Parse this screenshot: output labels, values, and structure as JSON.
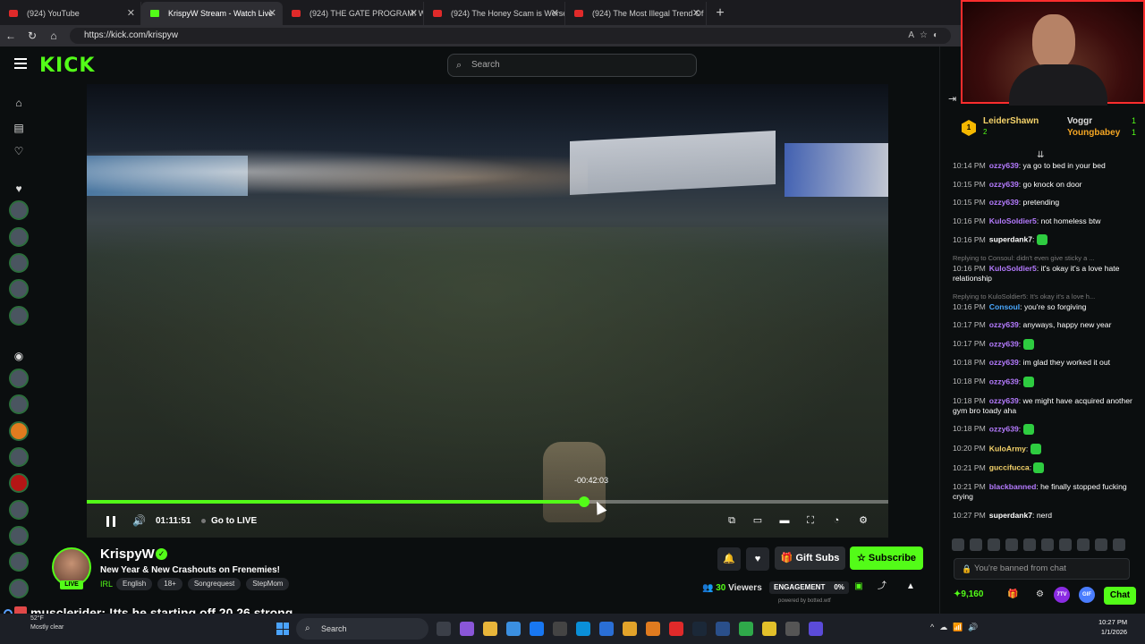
{
  "browser": {
    "tabs": [
      {
        "title": "(924) YouTube",
        "favicon": "youtube-icon",
        "active": false
      },
      {
        "title": "KrispyW Stream - Watch Live",
        "favicon": "kick-icon",
        "active": true
      },
      {
        "title": "(924) THE GATE PROGRAM: Were",
        "favicon": "youtube-icon",
        "active": false
      },
      {
        "title": "(924) The Honey Scam is Worse Th",
        "favicon": "youtube-icon",
        "active": false
      },
      {
        "title": "(924) The Most Illegal Trend Of 20",
        "favicon": "youtube-icon",
        "active": false
      }
    ],
    "url": "https://kick.com/krispyw"
  },
  "kick": {
    "logo": "KICK",
    "search_placeholder": "Search"
  },
  "player": {
    "seek_tooltip": "-00:42:03",
    "progress_fraction": 0.62,
    "time": "01:11:51",
    "go_live": "Go to LIVE"
  },
  "stream": {
    "streamer": "KrispyW",
    "title": "New Year & New Crashouts on Frenemies!",
    "category": "IRL",
    "live_badge": "LIVE",
    "tags": [
      "English",
      "18+",
      "Songrequest",
      "StepMom"
    ],
    "gift_label": "Gift Subs",
    "subscribe_label": "Subscribe",
    "viewers_count": "30",
    "viewers_label": "Viewers",
    "engagement_label": "ENGAGEMENT",
    "engagement_value": "0%",
    "powered_by": "powered by botted.wtf"
  },
  "chat": {
    "leaderboard": {
      "rank": "1",
      "first_name": "LeiderShawn",
      "first_count": "2",
      "second_name": "Voggr",
      "second_count": "1",
      "third_name": "Youngbabey",
      "third_count": "1"
    },
    "messages": [
      {
        "time": "10:14 PM",
        "user": "ozzy639",
        "color": "#b57bff",
        "text": "ya go to bed in your bed"
      },
      {
        "time": "10:15 PM",
        "user": "ozzy639",
        "color": "#b57bff",
        "text": "go knock on door"
      },
      {
        "time": "10:15 PM",
        "user": "ozzy639",
        "color": "#b57bff",
        "text": "pretending"
      },
      {
        "time": "10:16 PM",
        "user": "KuloSoldier5",
        "color": "#b57bff",
        "text": "not homeless btw"
      },
      {
        "time": "10:16 PM",
        "user": "superdank7",
        "color": "#ffffff",
        "text": "",
        "emote": true
      },
      {
        "reply": "Replying to Consoul: didn't even give sticky a ...",
        "time": "10:16 PM",
        "user": "KuloSoldier5",
        "color": "#b57bff",
        "text": "it's okay it's a love hate relationship"
      },
      {
        "reply": "Replying to KuloSoldier5: It's okay it's a love h...",
        "time": "10:16 PM",
        "user": "Consoul",
        "color": "#4aa8ff",
        "text": "you're so forgiving"
      },
      {
        "time": "10:17 PM",
        "user": "ozzy639",
        "color": "#b57bff",
        "text": "anyways, happy new year"
      },
      {
        "time": "10:17 PM",
        "user": "ozzy639",
        "color": "#b57bff",
        "text": "",
        "emote": true
      },
      {
        "time": "10:18 PM",
        "user": "ozzy639",
        "color": "#b57bff",
        "text": "im glad they worked it out"
      },
      {
        "time": "10:18 PM",
        "user": "ozzy639",
        "color": "#b57bff",
        "text": "",
        "emote": true
      },
      {
        "time": "10:18 PM",
        "user": "ozzy639",
        "color": "#b57bff",
        "text": "we might have acquired another gym bro toady aha"
      },
      {
        "time": "10:18 PM",
        "user": "ozzy639",
        "color": "#b57bff",
        "text": "",
        "emote": true
      },
      {
        "time": "10:20 PM",
        "user": "KuloArmy",
        "color": "#f5d36a",
        "text": "",
        "emote": true
      },
      {
        "time": "10:21 PM",
        "user": "guccifucca",
        "color": "#f5d36a",
        "text": "",
        "emote": true
      },
      {
        "time": "10:21 PM",
        "user": "blackbanned",
        "color": "#b57bff",
        "text": "he finally stopped fucking crying"
      },
      {
        "time": "10:27 PM",
        "user": "superdank7",
        "color": "#ffffff",
        "text": "nerd"
      }
    ],
    "banned_text": "You're banned from chat",
    "points": "9,160",
    "chat_button": "Chat",
    "badge_7tv": "7TV",
    "badge_gif": "GIF"
  },
  "donation": {
    "user": "musclerider",
    "text": ": !tts he starting off 20 26 strong"
  },
  "taskbar": {
    "weather_temp": "52°F",
    "weather_desc": "Mostly clear",
    "search": "Search",
    "time": "10:27 PM",
    "date": "1/1/2026"
  },
  "colors": {
    "kick_green": "#53fc18",
    "background": "#0b0e0f"
  }
}
